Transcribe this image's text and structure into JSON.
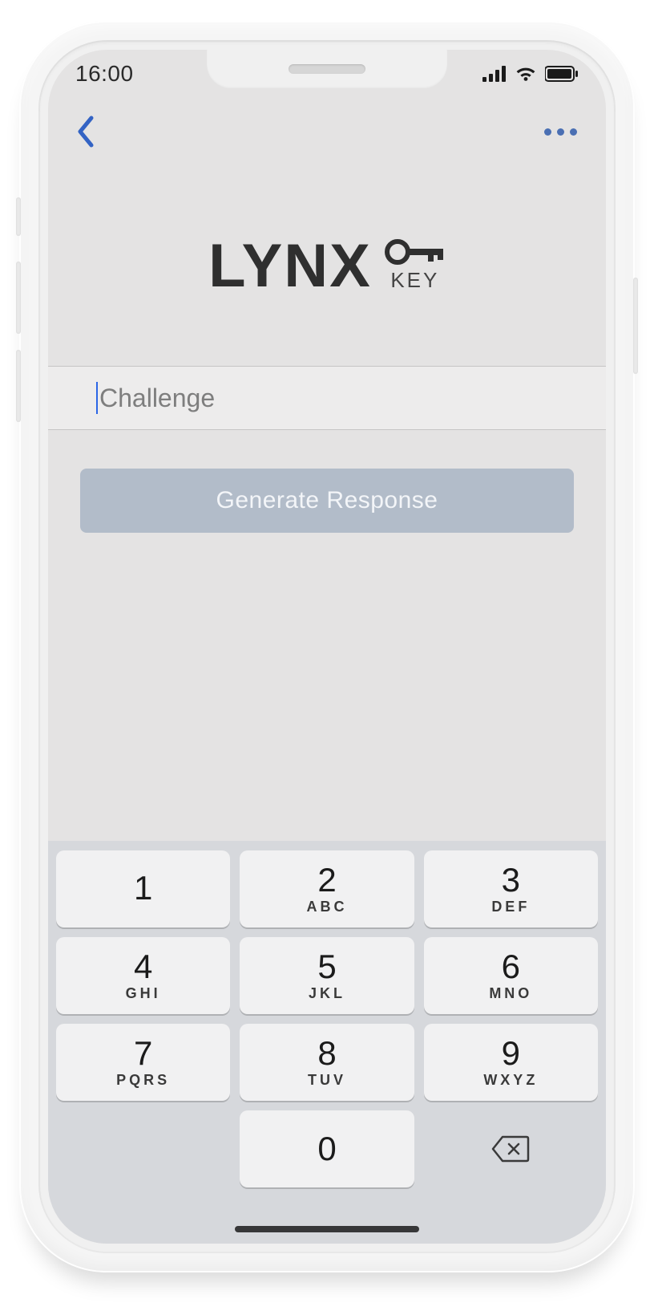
{
  "status": {
    "time": "16:00"
  },
  "logo": {
    "word": "LYNX",
    "sub": "KEY"
  },
  "challenge": {
    "placeholder": "Challenge",
    "value": ""
  },
  "actions": {
    "generate_label": "Generate Response"
  },
  "keypad": {
    "rows": [
      [
        {
          "num": "1",
          "sub": ""
        },
        {
          "num": "2",
          "sub": "ABC"
        },
        {
          "num": "3",
          "sub": "DEF"
        }
      ],
      [
        {
          "num": "4",
          "sub": "GHI"
        },
        {
          "num": "5",
          "sub": "JKL"
        },
        {
          "num": "6",
          "sub": "MNO"
        }
      ],
      [
        {
          "num": "7",
          "sub": "PQRS"
        },
        {
          "num": "8",
          "sub": "TUV"
        },
        {
          "num": "9",
          "sub": "WXYZ"
        }
      ],
      [
        {
          "num": "0",
          "sub": ""
        }
      ]
    ]
  }
}
